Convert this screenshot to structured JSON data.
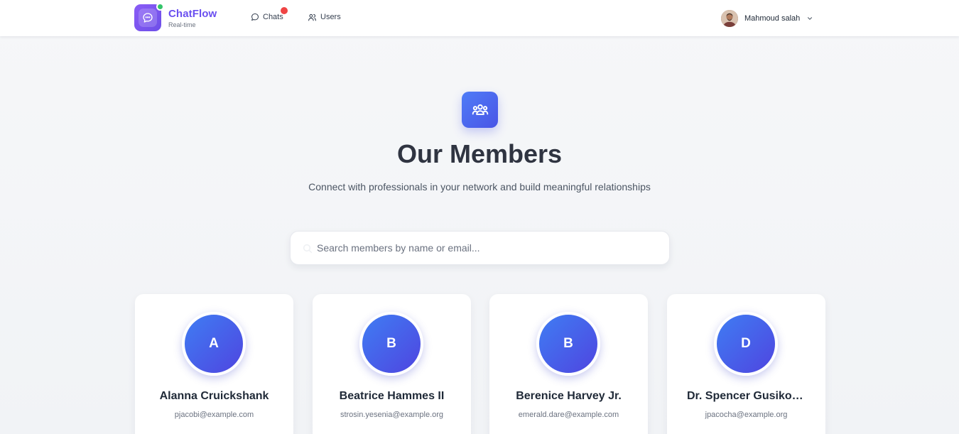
{
  "header": {
    "brand_name": "ChatFlow",
    "brand_tagline": "Real-time",
    "nav": [
      {
        "label": "Chats",
        "icon": "chat-bubble-icon",
        "has_notification": true
      },
      {
        "label": "Users",
        "icon": "users-icon"
      }
    ],
    "user": {
      "name": "Mahmoud salah"
    }
  },
  "hero": {
    "icon": "members-group-icon",
    "title": "Our Members",
    "subtitle": "Connect with professionals in your network and build meaningful relationships"
  },
  "search": {
    "placeholder": "Search members by name or email..."
  },
  "members": [
    {
      "initial": "A",
      "name": "Alanna Cruickshank",
      "email": "pjacobi@example.com"
    },
    {
      "initial": "B",
      "name": "Beatrice Hammes II",
      "email": "strosin.yesenia@example.org"
    },
    {
      "initial": "B",
      "name": "Berenice Harvey Jr.",
      "email": "emerald.dare@example.com"
    },
    {
      "initial": "D",
      "name": "Dr. Spencer Gusikowski",
      "email": "jpacocha@example.org"
    }
  ],
  "colors": {
    "brand": "#6a4ff0",
    "accent_gradient_start": "#3f7df3",
    "accent_gradient_end": "#4f45e0",
    "online": "#34c46a",
    "notification": "#ef4444"
  }
}
